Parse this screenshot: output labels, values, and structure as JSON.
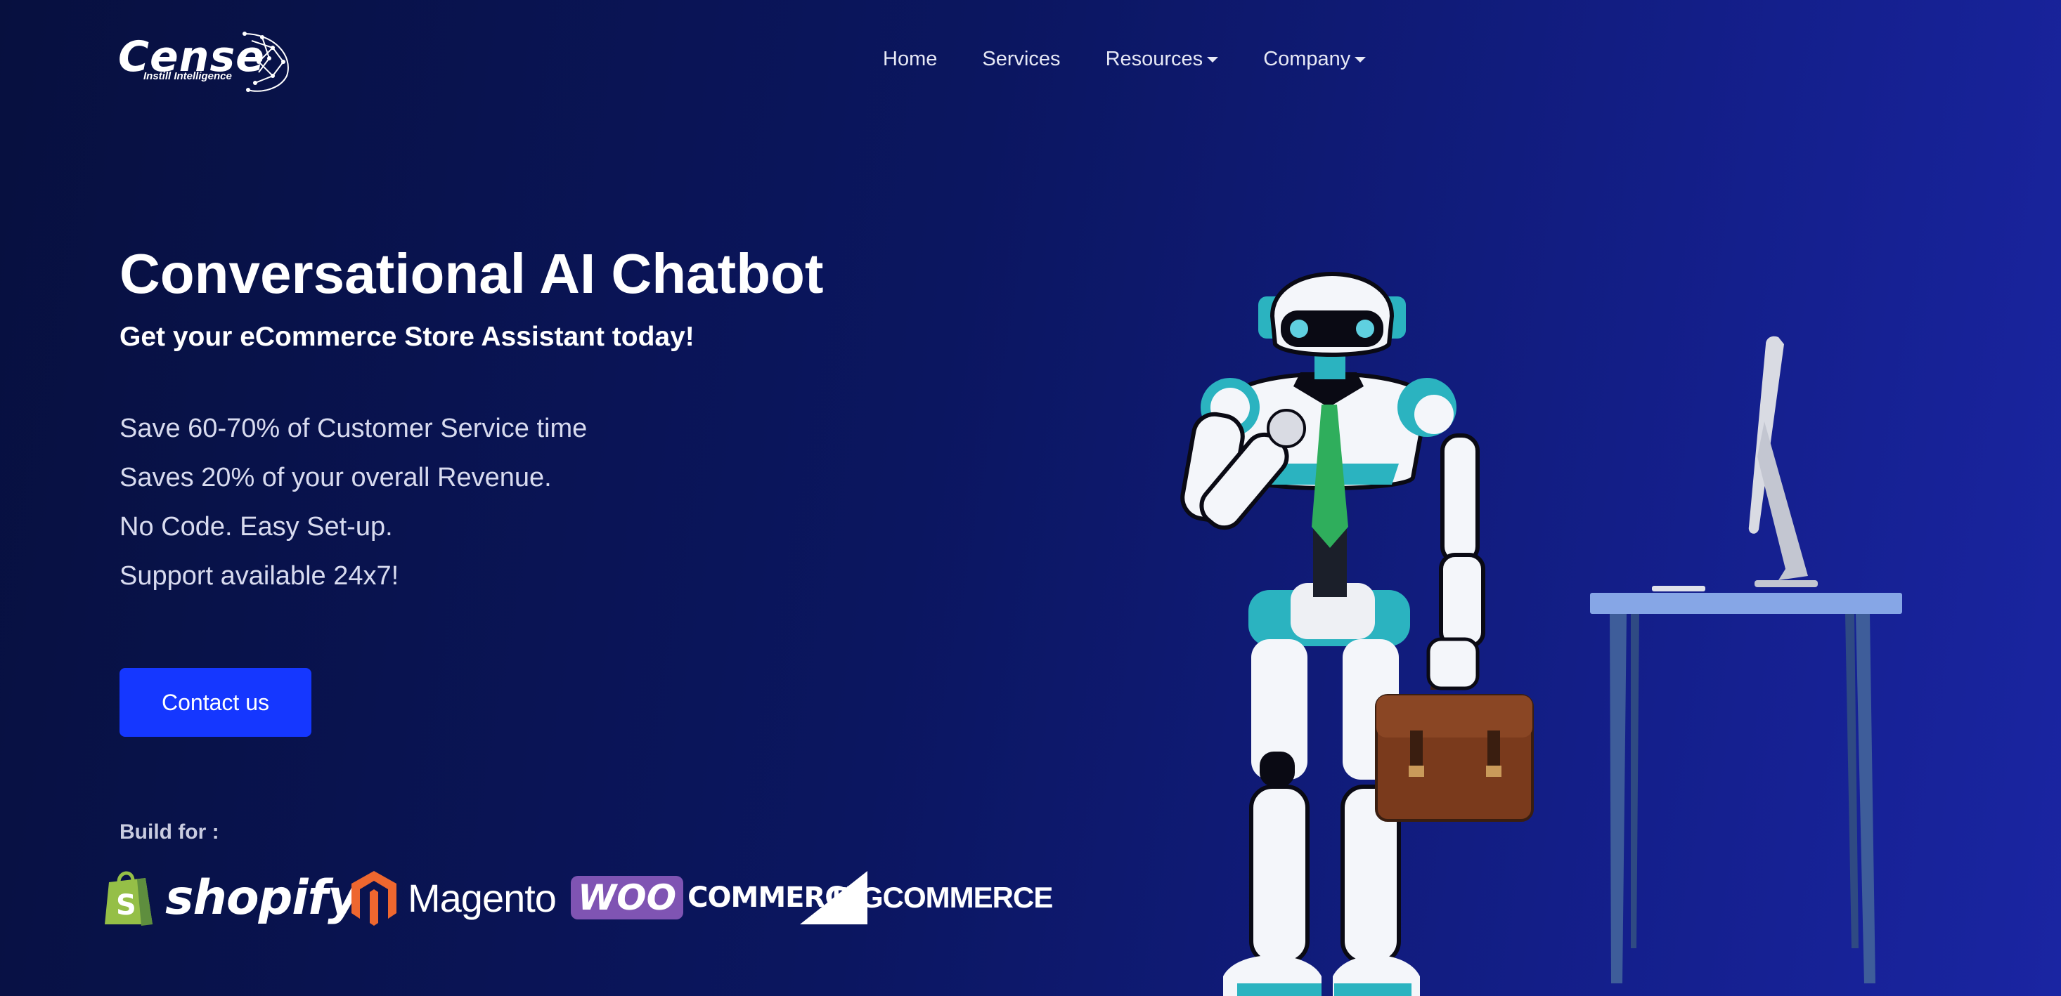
{
  "logo": {
    "name": "Cense",
    "tagline": "Instill Intelligence"
  },
  "nav": {
    "items": [
      {
        "label": "Home"
      },
      {
        "label": "Services"
      },
      {
        "label": "Resources",
        "dropdown": true
      },
      {
        "label": "Company",
        "dropdown": true
      }
    ]
  },
  "hero": {
    "title": "Conversational AI Chatbot",
    "subtitle": "Get your eCommerce Store Assistant today!",
    "features": [
      "Save 60-70% of Customer Service time",
      "Saves 20% of your overall Revenue.",
      "No Code. Easy Set-up.",
      "Support available 24x7!"
    ],
    "cta_label": "Contact us"
  },
  "platforms": {
    "label": "Build for :",
    "shopify": "shopify",
    "magento": "Magento",
    "woo_badge": "WOO",
    "woo_word": "COMMERCE",
    "bigcommerce": "BIGCOMMERCE"
  },
  "colors": {
    "background_start": "#07103f",
    "background_end": "#1a25a2",
    "cta": "#1537ff",
    "robot_accent": "#2bb3c0",
    "tie": "#2fae5c"
  },
  "icons": [
    "robot-illustration",
    "desk-illustration",
    "monitor-illustration",
    "briefcase-illustration",
    "caret-down-icon"
  ]
}
